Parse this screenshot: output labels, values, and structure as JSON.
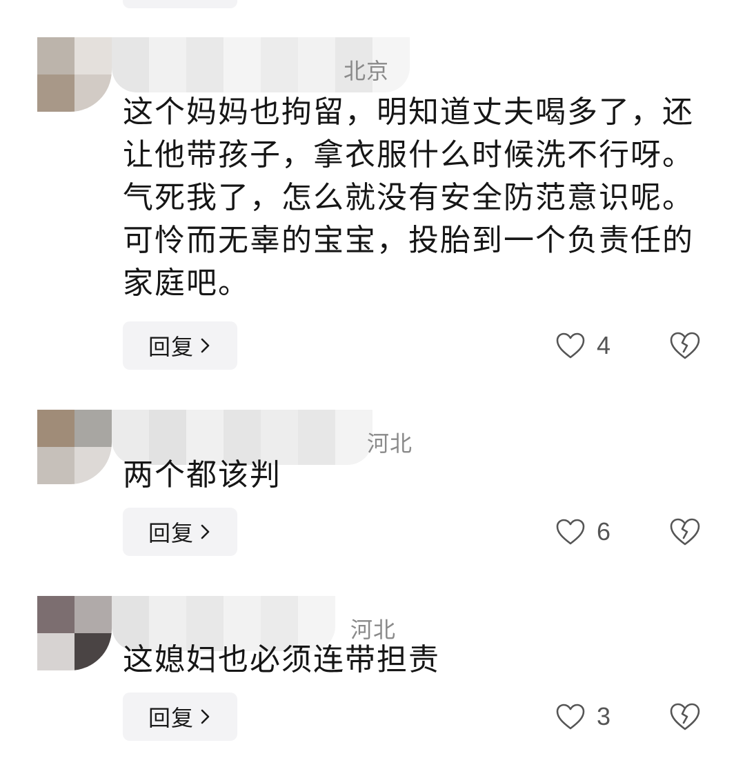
{
  "comments": [
    {
      "location": "北京",
      "text": "这个妈妈也拘留，明知道丈夫喝多了，还让他带孩子，拿衣服什么时候洗不行呀。气死我了，怎么就没有安全防范意识呢。可怜而无辜的宝宝，投胎到一个负责任的家庭吧。",
      "reply_label": "回复",
      "likes": "4"
    },
    {
      "location": "河北",
      "text": "两个都该判",
      "reply_label": "回复",
      "likes": "6"
    },
    {
      "location": "河北",
      "text": "这媳妇也必须连带担责",
      "reply_label": "回复",
      "likes": "3"
    }
  ],
  "icons": {
    "like": "heart-outline-icon",
    "dislike": "broken-heart-icon",
    "reply_chevron": "chevron-right-icon"
  },
  "colors": {
    "text": "#161616",
    "location": "#8a8a8a",
    "reply_bg": "#f3f3f5",
    "icon": "#555555"
  }
}
